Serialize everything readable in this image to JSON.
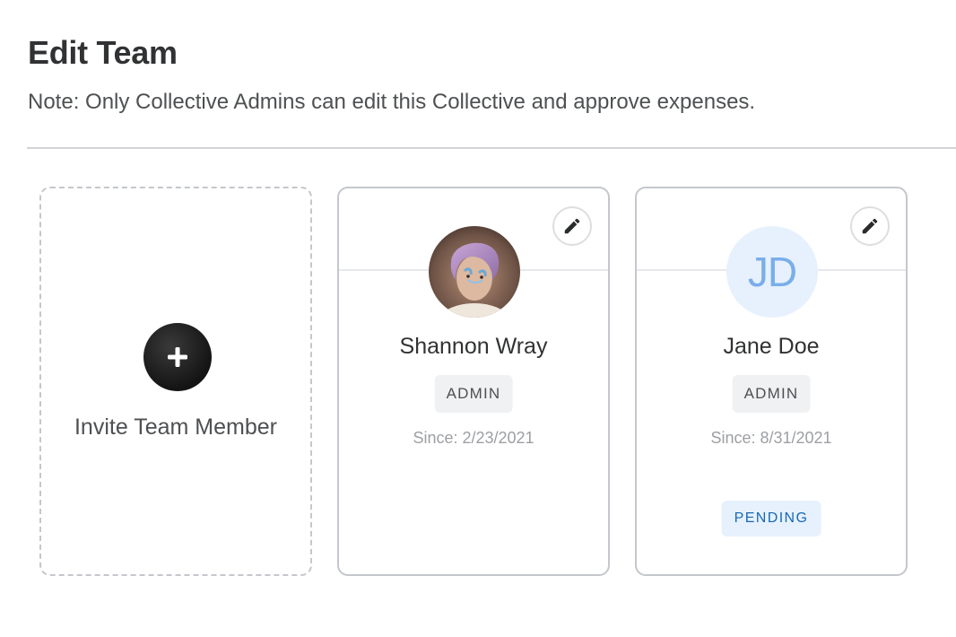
{
  "header": {
    "title": "Edit Team",
    "note": "Note: Only Collective Admins can edit this Collective and approve expenses."
  },
  "invite": {
    "label": "Invite Team Member",
    "icon": "plus-icon"
  },
  "members": [
    {
      "name": "Shannon Wray",
      "role": "ADMIN",
      "since": "Since: 2/23/2021",
      "avatar": "photo",
      "edit_icon": "pencil-icon"
    },
    {
      "name": "Jane Doe",
      "initials": "JD",
      "role": "ADMIN",
      "since": "Since: 8/31/2021",
      "status": "PENDING",
      "avatar": "initials",
      "edit_icon": "pencil-icon"
    }
  ],
  "colors": {
    "accent_blue": "#1869b5",
    "pending_bg": "#e6f1fd",
    "badge_bg": "#f0f1f3",
    "card_border": "#c4c7cc",
    "text_dark": "#313233"
  }
}
